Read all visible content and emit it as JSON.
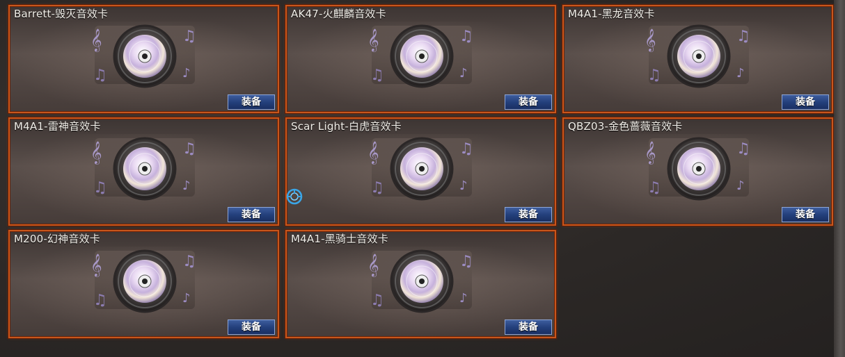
{
  "cards": [
    {
      "title": "Barrett-毁灭音效卡",
      "button": "装备",
      "icon": "music-disc-icon"
    },
    {
      "title": "AK47-火麒麟音效卡",
      "button": "装备",
      "icon": "music-disc-icon"
    },
    {
      "title": "M4A1-黑龙音效卡",
      "button": "装备",
      "icon": "music-disc-icon"
    },
    {
      "title": "M4A1-雷神音效卡",
      "button": "装备",
      "icon": "music-disc-icon"
    },
    {
      "title": "Scar Light-白虎音效卡",
      "button": "装备",
      "icon": "music-disc-icon"
    },
    {
      "title": "QBZ03-金色蔷薇音效卡",
      "button": "装备",
      "icon": "music-disc-icon"
    },
    {
      "title": "M200-幻神音效卡",
      "button": "装备",
      "icon": "music-disc-icon"
    },
    {
      "title": "M4A1-黑骑士音效卡",
      "button": "装备",
      "icon": "music-disc-icon"
    }
  ],
  "colors": {
    "card_border": "#c8561c",
    "button_bg": "#24407c",
    "cursor_ring": "#3aa6e8"
  }
}
